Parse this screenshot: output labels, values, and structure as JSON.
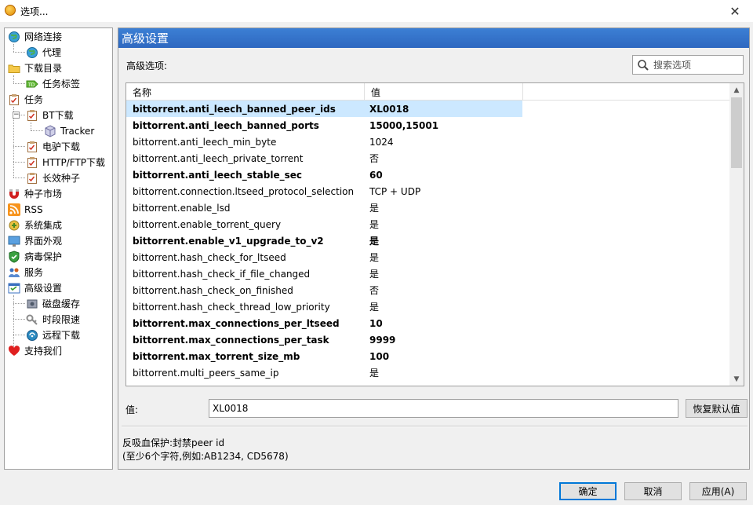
{
  "window": {
    "title": "选项..."
  },
  "sidebar": {
    "items": [
      {
        "label": "网络连接",
        "icon": "globe-icon",
        "level": 0
      },
      {
        "label": "代理",
        "icon": "globe-icon",
        "level": 1
      },
      {
        "label": "下载目录",
        "icon": "folder-icon",
        "level": 0
      },
      {
        "label": "任务标签",
        "icon": "tag-icon",
        "level": 1
      },
      {
        "label": "任务",
        "icon": "clipboard-icon",
        "level": 0
      },
      {
        "label": "BT下载",
        "icon": "clipboard-icon",
        "level": 1
      },
      {
        "label": "Tracker",
        "icon": "cube-icon",
        "level": 2
      },
      {
        "label": "电驴下载",
        "icon": "clipboard-icon",
        "level": 1
      },
      {
        "label": "HTTP/FTP下载",
        "icon": "clipboard-icon",
        "level": 1
      },
      {
        "label": "长效种子",
        "icon": "clipboard-icon",
        "level": 1
      },
      {
        "label": "种子市场",
        "icon": "magnet-icon",
        "level": 0
      },
      {
        "label": "RSS",
        "icon": "rss-icon",
        "level": 0
      },
      {
        "label": "系统集成",
        "icon": "system-icon",
        "level": 0
      },
      {
        "label": "界面外观",
        "icon": "appearance-icon",
        "level": 0
      },
      {
        "label": "病毒保护",
        "icon": "shield-icon",
        "level": 0
      },
      {
        "label": "服务",
        "icon": "people-icon",
        "level": 0
      },
      {
        "label": "高级设置",
        "icon": "advanced-icon",
        "level": 0
      },
      {
        "label": "磁盘缓存",
        "icon": "disk-icon",
        "level": 1
      },
      {
        "label": "时段限速",
        "icon": "key-icon",
        "level": 1
      },
      {
        "label": "远程下载",
        "icon": "remote-icon",
        "level": 1
      },
      {
        "label": "支持我们",
        "icon": "heart-icon",
        "level": 0
      }
    ]
  },
  "panel": {
    "header": "高级设置",
    "options_label": "高级选项:",
    "search_placeholder": "搜索选项",
    "columns": [
      "名称",
      "值"
    ],
    "rows": [
      {
        "name": "bittorrent.anti_leech_banned_peer_ids",
        "value": "XL0018",
        "bold": true,
        "selected": true
      },
      {
        "name": "bittorrent.anti_leech_banned_ports",
        "value": "15000,15001",
        "bold": true
      },
      {
        "name": "bittorrent.anti_leech_min_byte",
        "value": "1024",
        "bold": false
      },
      {
        "name": "bittorrent.anti_leech_private_torrent",
        "value": "否",
        "bold": false
      },
      {
        "name": "bittorrent.anti_leech_stable_sec",
        "value": "60",
        "bold": true
      },
      {
        "name": "bittorrent.connection.ltseed_protocol_selection",
        "value": "TCP + UDP",
        "bold": false
      },
      {
        "name": "bittorrent.enable_lsd",
        "value": "是",
        "bold": false
      },
      {
        "name": "bittorrent.enable_torrent_query",
        "value": "是",
        "bold": false
      },
      {
        "name": "bittorrent.enable_v1_upgrade_to_v2",
        "value": "是",
        "bold": true
      },
      {
        "name": "bittorrent.hash_check_for_ltseed",
        "value": "是",
        "bold": false
      },
      {
        "name": "bittorrent.hash_check_if_file_changed",
        "value": "是",
        "bold": false
      },
      {
        "name": "bittorrent.hash_check_on_finished",
        "value": "否",
        "bold": false
      },
      {
        "name": "bittorrent.hash_check_thread_low_priority",
        "value": "是",
        "bold": false
      },
      {
        "name": "bittorrent.max_connections_per_ltseed",
        "value": "10",
        "bold": true
      },
      {
        "name": "bittorrent.max_connections_per_task",
        "value": "9999",
        "bold": true
      },
      {
        "name": "bittorrent.max_torrent_size_mb",
        "value": "100",
        "bold": true
      },
      {
        "name": "bittorrent.multi_peers_same_ip",
        "value": "是",
        "bold": false
      }
    ],
    "value_label": "值:",
    "value_input": "XL0018",
    "restore_button": "恢复默认值",
    "desc_line1": "反吸血保护:封禁peer id",
    "desc_line2": "(至少6个字符,例如:AB1234, CD5678)"
  },
  "buttons": {
    "ok": "确定",
    "cancel": "取消",
    "apply": "应用(A)"
  }
}
